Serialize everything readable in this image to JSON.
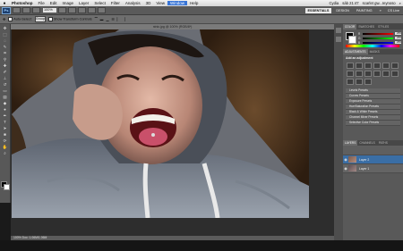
{
  "menubar": {
    "apple": "",
    "items": [
      "Photoshop",
      "File",
      "Edit",
      "Image",
      "Layer",
      "Select",
      "Filter",
      "Analysis",
      "3D",
      "View",
      "Window",
      "Help"
    ],
    "active_item": "Window",
    "status_right": [
      "Cydia",
      "sáb 21:47",
      "scarlet gw...reynoso"
    ]
  },
  "appbar": {
    "badge": "Ps",
    "zoom": "100%",
    "workspaces": [
      "ESSENTIALS",
      "DESIGN",
      "PAINTING"
    ],
    "active_workspace": "ESSENTIALS",
    "more": "»",
    "cs_live": "CS Live"
  },
  "options": {
    "auto_select_label": "Auto-Select:",
    "auto_select_value": "Group",
    "show_transform_label": "Show Transform Controls"
  },
  "document": {
    "tab_title": "ninic.jpg @ 100% (RGB/8*)",
    "status": "100%   Doc: 1.06M/1.06M"
  },
  "panels": {
    "color_tabs": [
      "COLOR",
      "SWATCHES",
      "STYLES"
    ],
    "rgb": [
      {
        "label": "R",
        "value": "255"
      },
      {
        "label": "G",
        "value": "255"
      },
      {
        "label": "B",
        "value": "255"
      }
    ],
    "adjust_tabs": [
      "ADJUSTMENTS",
      "MASKS"
    ],
    "adjust_title": "Add an adjustment",
    "presets": [
      "Levels Presets",
      "Curves Presets",
      "Exposure Presets",
      "Hue/Saturation Presets",
      "Black & White Presets",
      "Channel Mixer Presets",
      "Selective Color Presets"
    ],
    "layer_tabs": [
      "LAYERS",
      "CHANNELS",
      "PATHS"
    ],
    "layers": [
      {
        "name": "Layer 2",
        "selected": true
      },
      {
        "name": "Layer 1",
        "selected": false
      }
    ]
  },
  "colors": {
    "accent": "#3875d7",
    "panel_bg": "#595959",
    "essentials_bg": "#e8e8e8"
  }
}
